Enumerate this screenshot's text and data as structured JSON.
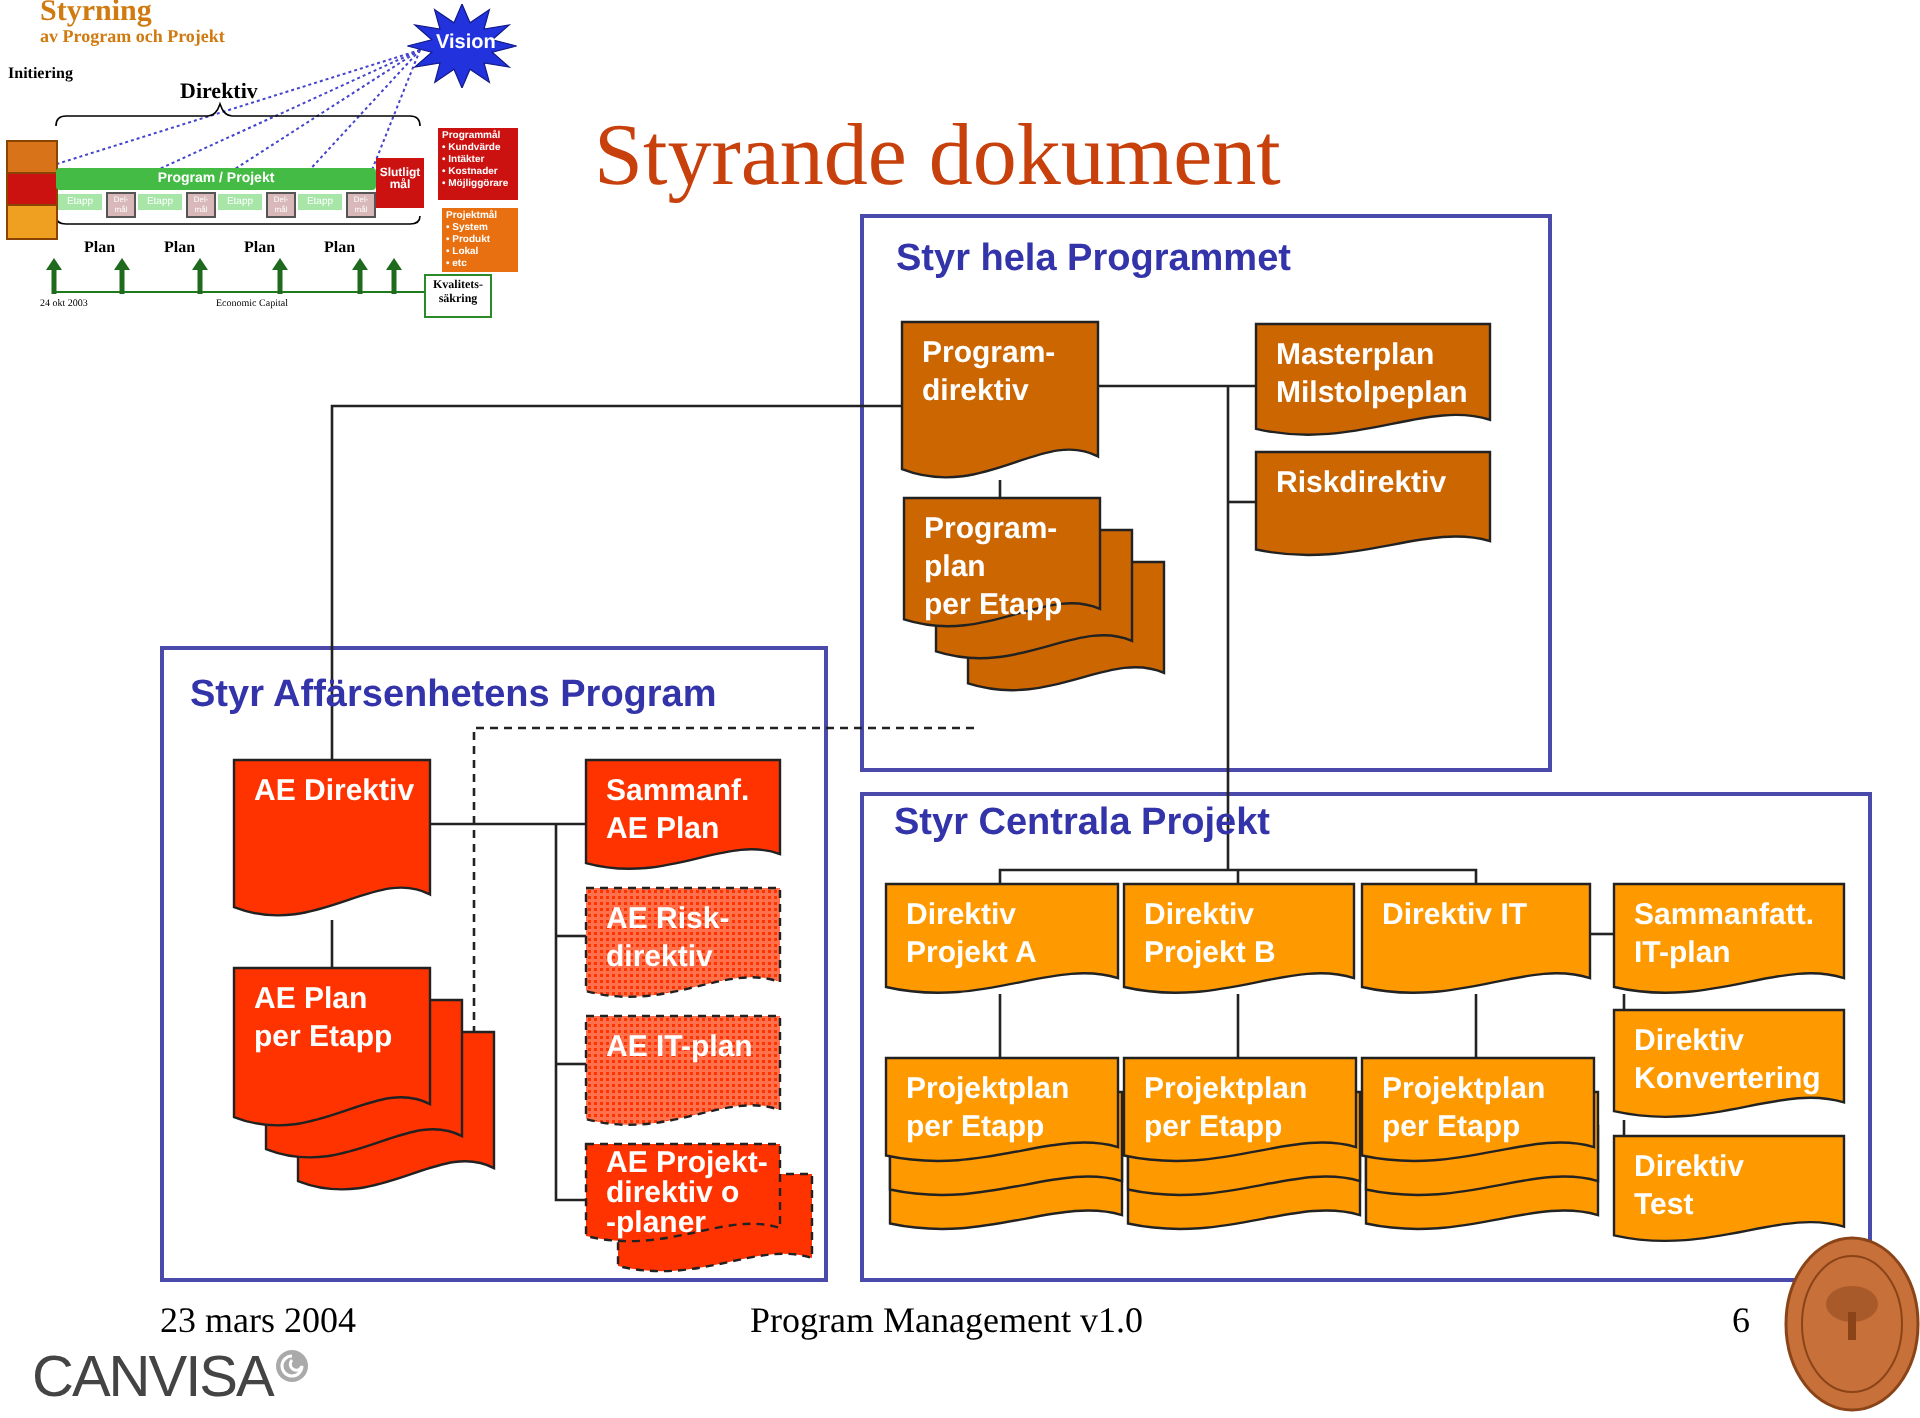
{
  "thumbnail": {
    "title": "Styrning",
    "subtitle": "av Program och Projekt",
    "phase": "Initiering",
    "directive": "Direktiv",
    "vision": "Vision",
    "bar": "Program / Projekt",
    "stages": [
      {
        "label": "Etapp",
        "milestone": "Del-mål"
      },
      {
        "label": "Etapp",
        "milestone": "Del-mål"
      },
      {
        "label": "Etapp",
        "milestone": "Del-mål"
      },
      {
        "label": "Etapp",
        "milestone": "Del-mål"
      }
    ],
    "plans": [
      "Plan",
      "Plan",
      "Plan",
      "Plan"
    ],
    "goal": "Slutligt mål",
    "program_goals": {
      "heading": "Programmål",
      "items": [
        "• Kundvärde",
        "• Intäkter",
        "• Kostnader",
        "• Möjliggörare"
      ]
    },
    "project_goals": {
      "heading": "Projektmål",
      "items": [
        "• System",
        "• Produkt",
        "• Lokal",
        "• etc"
      ]
    },
    "quality": "Kvalitets-\nsäkring",
    "date": "24 okt 2003",
    "company": "Economic Capital"
  },
  "title": "Styrande dokument",
  "groups": [
    {
      "title": "Styr hela Programmet",
      "color": "#cc6600",
      "documents": [
        {
          "text": "Program-\ndirektiv",
          "kind": "single"
        },
        {
          "text": "Masterplan\nMilstolpeplan",
          "kind": "single"
        },
        {
          "text": "Riskdirektiv",
          "kind": "single"
        },
        {
          "text": "Program-\nplan\nper Etapp",
          "kind": "stack"
        }
      ]
    },
    {
      "title": "Styr Affärsenhetens Program",
      "color": "#ff3300",
      "documents": [
        {
          "text": "AE Direktiv",
          "kind": "single"
        },
        {
          "text": "AE Plan\nper Etapp",
          "kind": "stack"
        },
        {
          "text": "Sammanf.\nAE Plan",
          "kind": "single"
        },
        {
          "text": "AE Risk-\ndirektiv",
          "kind": "dashed"
        },
        {
          "text": "AE IT-plan",
          "kind": "dashed"
        },
        {
          "text": "AE Projekt-\ndirektiv o\n-planer",
          "kind": "dashed_stack"
        }
      ]
    },
    {
      "title": "Styr Centrala Projekt",
      "color": "#ff9900",
      "documents": [
        {
          "text": "Direktiv\nProjekt A",
          "kind": "single"
        },
        {
          "text": "Direktiv\nProjekt B",
          "kind": "single"
        },
        {
          "text": "Direktiv IT",
          "kind": "single"
        },
        {
          "text": "Sammanfatt.\nIT-plan",
          "kind": "single"
        },
        {
          "text": "Projektplan\nper Etapp",
          "kind": "pile"
        },
        {
          "text": "Projektplan\nper Etapp",
          "kind": "pile"
        },
        {
          "text": "Projektplan\nper Etapp",
          "kind": "pile"
        },
        {
          "text": "Direktiv\nKonvertering",
          "kind": "single"
        },
        {
          "text": "Direktiv\nTest",
          "kind": "single"
        }
      ]
    }
  ],
  "footer": {
    "date": "23 mars 2004",
    "name": "Program Management v1.0",
    "page": "6",
    "logo": "CANVISA"
  }
}
